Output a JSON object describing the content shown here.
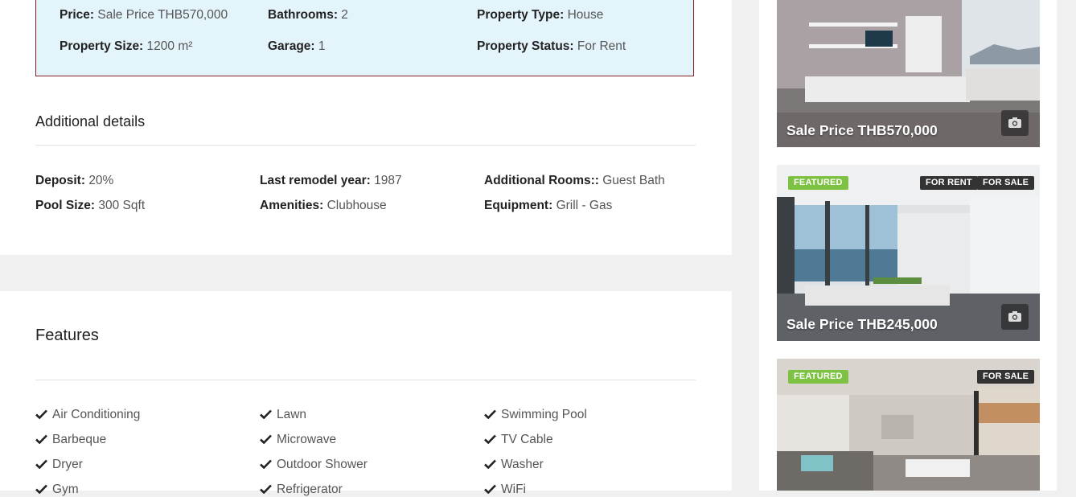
{
  "overview": {
    "price": {
      "label": "Price:",
      "value": "Sale Price THB570,000"
    },
    "bathrooms": {
      "label": "Bathrooms:",
      "value": "2"
    },
    "property_type": {
      "label": "Property Type:",
      "value": "House"
    },
    "property_size": {
      "label": "Property Size:",
      "value": "1200 m²"
    },
    "garage": {
      "label": "Garage:",
      "value": "1"
    },
    "property_status": {
      "label": "Property Status:",
      "value": "For Rent"
    }
  },
  "additional": {
    "title": "Additional details",
    "deposit": {
      "label": "Deposit:",
      "value": "20%"
    },
    "remodel": {
      "label": "Last remodel year:",
      "value": "1987"
    },
    "rooms": {
      "label": "Additional Rooms::",
      "value": "Guest Bath"
    },
    "pool": {
      "label": "Pool Size:",
      "value": "300 Sqft"
    },
    "amenities": {
      "label": "Amenities:",
      "value": "Clubhouse"
    },
    "equipment": {
      "label": "Equipment:",
      "value": "Grill - Gas"
    }
  },
  "features": {
    "title": "Features",
    "items": [
      "Air Conditioning",
      "Lawn",
      "Swimming Pool",
      "Barbeque",
      "Microwave",
      "TV Cable",
      "Dryer",
      "Outdoor Shower",
      "Washer",
      "Gym",
      "Refrigerator",
      "WiFi"
    ]
  },
  "listings": [
    {
      "price": "Sale Price THB570,000",
      "badges": []
    },
    {
      "price": "Sale Price THB245,000",
      "badges": [
        "FEATURED",
        "FOR RENT",
        "FOR SALE"
      ]
    },
    {
      "price": "",
      "badges": [
        "FEATURED",
        "FOR SALE"
      ]
    }
  ],
  "colors": {
    "accent_green": "#7dc242",
    "box_bg": "#e4f4fb",
    "box_border": "#8b1e1e"
  }
}
